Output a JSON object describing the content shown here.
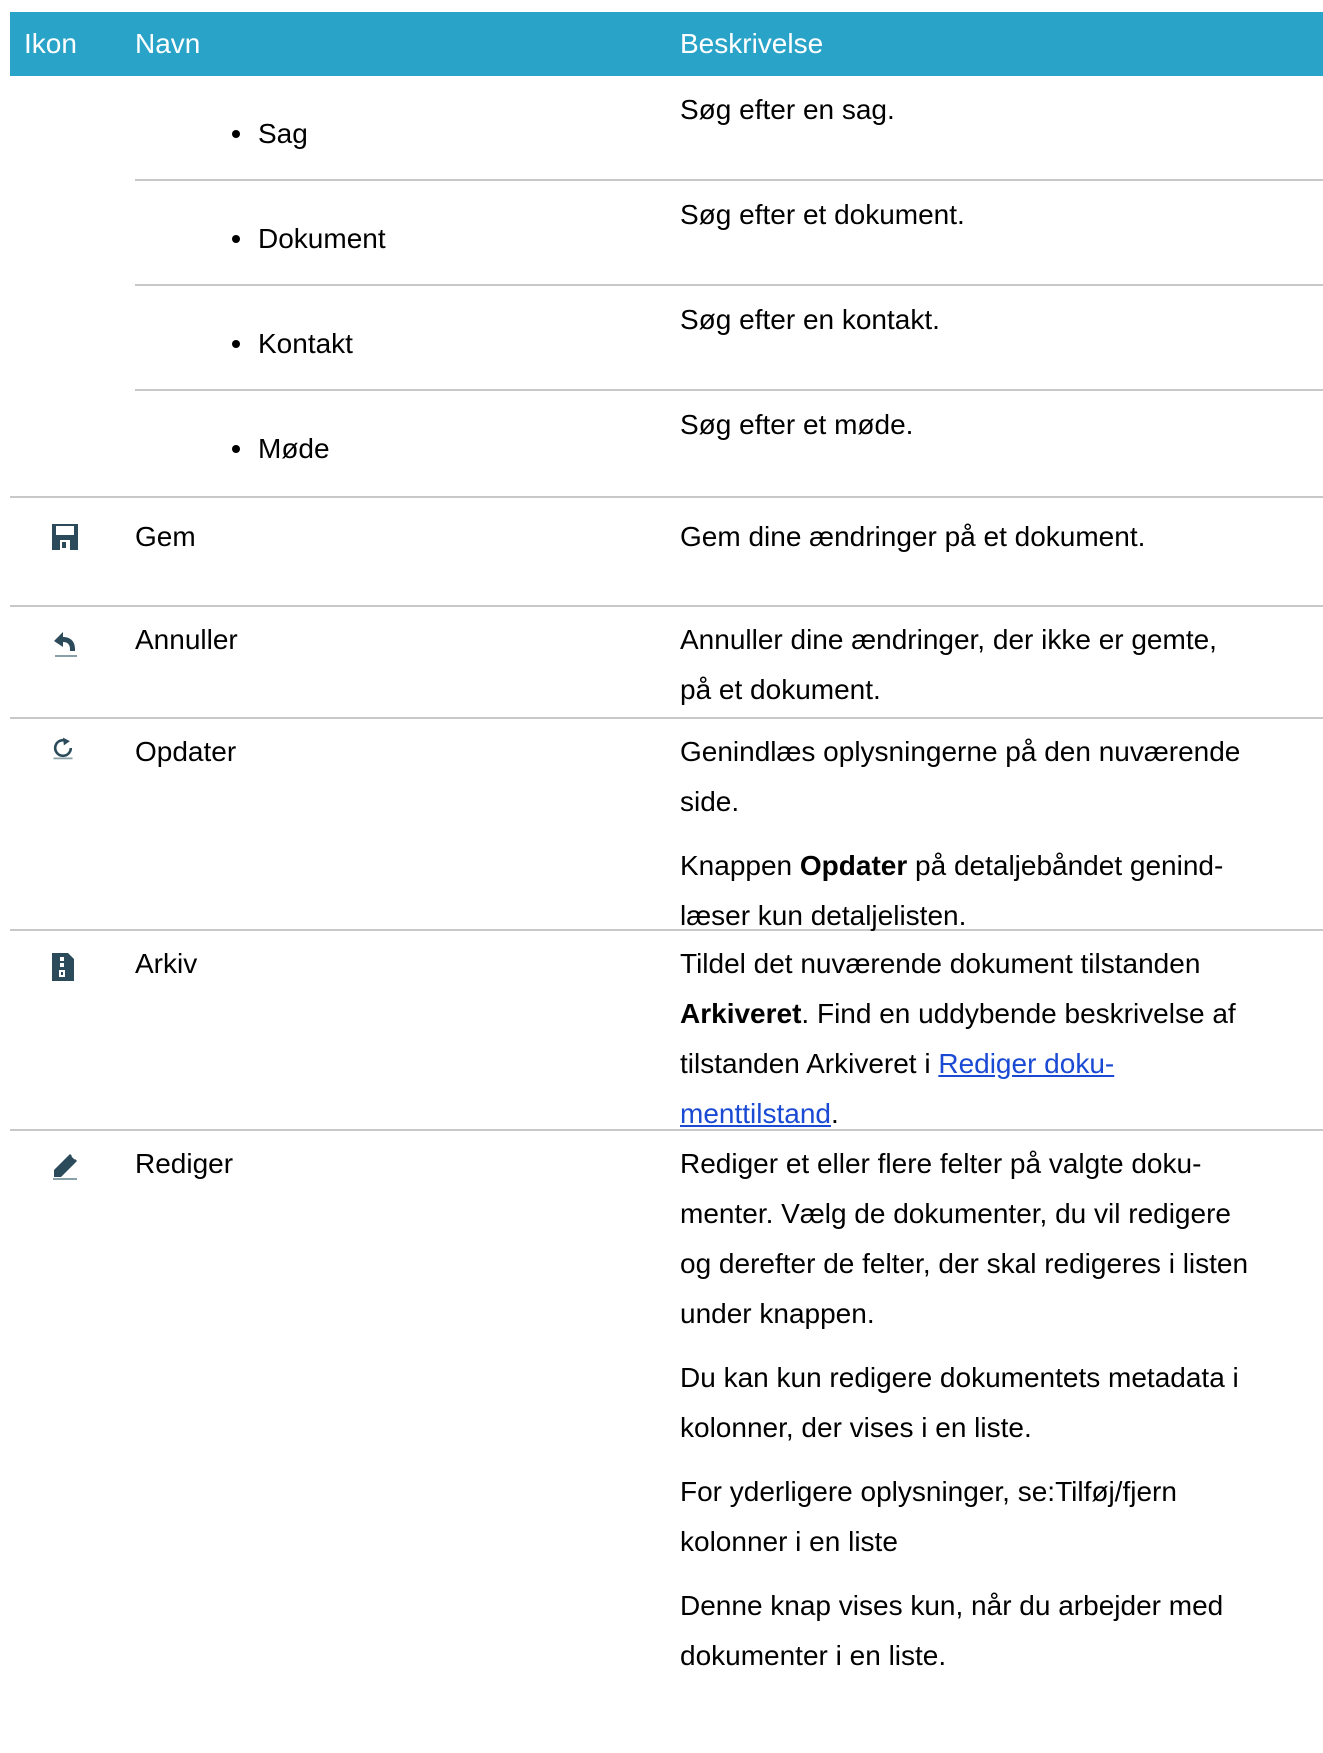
{
  "header": {
    "icon_col": "Ikon",
    "name_col": "Navn",
    "desc_col": "Beskrivelse"
  },
  "search_items": [
    {
      "name": "Sag",
      "desc": "Søg efter en sag."
    },
    {
      "name": "Dokument",
      "desc": "Søg efter et dokument."
    },
    {
      "name": "Kontakt",
      "desc": "Søg efter en kontakt."
    },
    {
      "name": "Møde",
      "desc": "Søg efter et møde."
    }
  ],
  "rows": {
    "gem": {
      "icon": "floppy-disk-icon",
      "name": "Gem",
      "desc": "Gem dine ændringer på et dokument."
    },
    "annuller": {
      "icon": "undo-arrow-icon",
      "name": "Annuller",
      "desc_line1": "Annuller dine ændringer, der ikke er gemte,",
      "desc_line2": "på et dokument."
    },
    "opdater": {
      "icon": "refresh-icon",
      "name": "Opdater",
      "desc_p1_line1": "Genindlæs oplysningerne på den nuværende",
      "desc_p1_line2": "side.",
      "desc_p2_pre": "Knappen ",
      "desc_p2_bold": "Opdater",
      "desc_p2_post": " på detaljebåndet genind-",
      "desc_p2_line2": "læser kun detaljelisten."
    },
    "arkiv": {
      "icon": "archive-document-icon",
      "name": "Arkiv",
      "desc_line1": "Tildel det nuværende dokument tilstanden",
      "desc_bold": "Arkiveret",
      "desc_line2_post": ". Find en uddybende beskrivelse af",
      "desc_line3_pre": "tilstanden Arkiveret i ",
      "link_line1": "Rediger doku-",
      "link_line2": "menttilstand",
      "desc_end": "."
    },
    "rediger": {
      "icon": "pencil-edit-icon",
      "name": "Rediger",
      "p1": [
        "Rediger et eller flere felter på valgte doku-",
        "menter. Vælg de dokumenter, du vil redigere",
        "og derefter de felter, der skal redigeres i listen",
        "under knappen."
      ],
      "p2": [
        "Du kan kun redigere dokumentets metadata i",
        "kolonner, der vises i en liste."
      ],
      "p3": [
        "For yderligere oplysninger, se:Tilføj/fjern",
        "kolonner i en liste"
      ],
      "p4": [
        "Denne knap vises kun, når du arbejder med",
        "dokumenter i en liste."
      ]
    }
  },
  "colors": {
    "header_bg": "#2aa3c8",
    "link": "#1a4ad4",
    "divider": "#c8c8c8"
  }
}
